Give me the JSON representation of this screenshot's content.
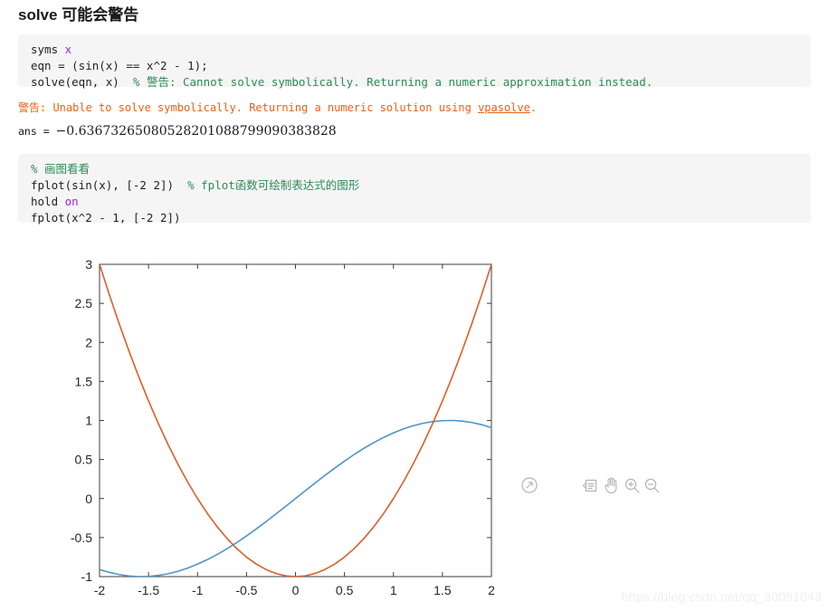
{
  "heading": "solve 可能会警告",
  "code_block_1": {
    "lines": [
      {
        "segments": [
          {
            "text": "syms ",
            "style": "plain"
          },
          {
            "text": "x",
            "style": "var"
          }
        ]
      },
      {
        "segments": [
          {
            "text": "eqn = (sin(x) == x^2 - 1);",
            "style": "plain"
          }
        ]
      },
      {
        "segments": [
          {
            "text": "solve(eqn, x)  ",
            "style": "plain"
          },
          {
            "text": "% 警告: Cannot solve symbolically. Returning a numeric approximation instead.",
            "style": "comment"
          }
        ]
      }
    ]
  },
  "output": {
    "warning_label": "警告:",
    "warning_text_before": " Unable to solve symbolically. Returning a numeric solution using ",
    "warning_link": "vpasolve",
    "warning_text_after": ".",
    "ans_key": "ans = ",
    "ans_value": "−0.63673265080528201088799090383828"
  },
  "code_block_2": {
    "lines": [
      {
        "segments": [
          {
            "text": "% 画图看看",
            "style": "comment"
          }
        ]
      },
      {
        "segments": [
          {
            "text": "fplot(sin(x), [-2 2])  ",
            "style": "plain"
          },
          {
            "text": "% fplot函数可绘制表达式的图形",
            "style": "comment"
          }
        ]
      },
      {
        "segments": [
          {
            "text": "hold ",
            "style": "plain"
          },
          {
            "text": "on",
            "style": "var"
          }
        ]
      },
      {
        "segments": [
          {
            "text": "fplot(x^2 - 1, [-2 2])",
            "style": "plain"
          }
        ]
      }
    ]
  },
  "toolbar": {
    "popout_label": "pop-out-figure",
    "legend_label": "legend",
    "pan_label": "pan",
    "zoom_in_label": "zoom-in",
    "zoom_out_label": "zoom-out"
  },
  "chart_data": {
    "type": "line",
    "title": "",
    "xlabel": "",
    "ylabel": "",
    "xlim": [
      -2,
      2
    ],
    "ylim": [
      -1,
      3
    ],
    "xticks": [
      -2,
      -1.5,
      -1,
      -0.5,
      0,
      0.5,
      1,
      1.5,
      2
    ],
    "xtick_labels": [
      "-2",
      "-1.5",
      "-1",
      "-0.5",
      "0",
      "0.5",
      "1",
      "1.5",
      "2"
    ],
    "yticks": [
      -1,
      -0.5,
      0,
      0.5,
      1,
      1.5,
      2,
      2.5,
      3
    ],
    "ytick_labels": [
      "-1",
      "-0.5",
      "0",
      "0.5",
      "1",
      "1.5",
      "2",
      "2.5",
      "3"
    ],
    "grid": false,
    "legend": "none",
    "box": true,
    "series": [
      {
        "name": "sin(x)",
        "color": "#4D96C8",
        "x": [
          -2,
          -1.9,
          -1.8,
          -1.7,
          -1.6,
          -1.5,
          -1.4,
          -1.3,
          -1.2,
          -1.1,
          -1,
          -0.9,
          -0.8,
          -0.7,
          -0.6,
          -0.5,
          -0.4,
          -0.3,
          -0.2,
          -0.1,
          0,
          0.1,
          0.2,
          0.3,
          0.4,
          0.5,
          0.6,
          0.7,
          0.8,
          0.9,
          1,
          1.1,
          1.2,
          1.3,
          1.4,
          1.5,
          1.6,
          1.7,
          1.8,
          1.9,
          2
        ],
        "values": [
          -0.909,
          -0.946,
          -0.974,
          -0.992,
          -1.0,
          -0.997,
          -0.985,
          -0.964,
          -0.932,
          -0.891,
          -0.841,
          -0.783,
          -0.717,
          -0.644,
          -0.565,
          -0.479,
          -0.389,
          -0.296,
          -0.199,
          -0.1,
          0,
          0.1,
          0.199,
          0.296,
          0.389,
          0.479,
          0.565,
          0.644,
          0.717,
          0.783,
          0.841,
          0.891,
          0.932,
          0.964,
          0.985,
          0.997,
          1.0,
          0.992,
          0.974,
          0.946,
          0.909
        ]
      },
      {
        "name": "x^2 - 1",
        "color": "#D95F2B",
        "x": [
          -2,
          -1.9,
          -1.8,
          -1.7,
          -1.6,
          -1.5,
          -1.4,
          -1.3,
          -1.2,
          -1.1,
          -1,
          -0.9,
          -0.8,
          -0.7,
          -0.6,
          -0.5,
          -0.4,
          -0.3,
          -0.2,
          -0.1,
          0,
          0.1,
          0.2,
          0.3,
          0.4,
          0.5,
          0.6,
          0.7,
          0.8,
          0.9,
          1,
          1.1,
          1.2,
          1.3,
          1.4,
          1.5,
          1.6,
          1.7,
          1.8,
          1.9,
          2
        ],
        "values": [
          3.0,
          2.61,
          2.24,
          1.89,
          1.56,
          1.25,
          0.96,
          0.69,
          0.44,
          0.21,
          0.0,
          -0.19,
          -0.36,
          -0.51,
          -0.64,
          -0.75,
          -0.84,
          -0.91,
          -0.96,
          -0.99,
          -1.0,
          -0.99,
          -0.96,
          -0.91,
          -0.84,
          -0.75,
          -0.64,
          -0.51,
          -0.36,
          -0.19,
          0.0,
          0.21,
          0.44,
          0.69,
          0.96,
          1.25,
          1.56,
          1.89,
          2.24,
          2.61,
          3.0
        ]
      }
    ]
  },
  "watermark": "https://blog.csdn.net/qq_30081043"
}
